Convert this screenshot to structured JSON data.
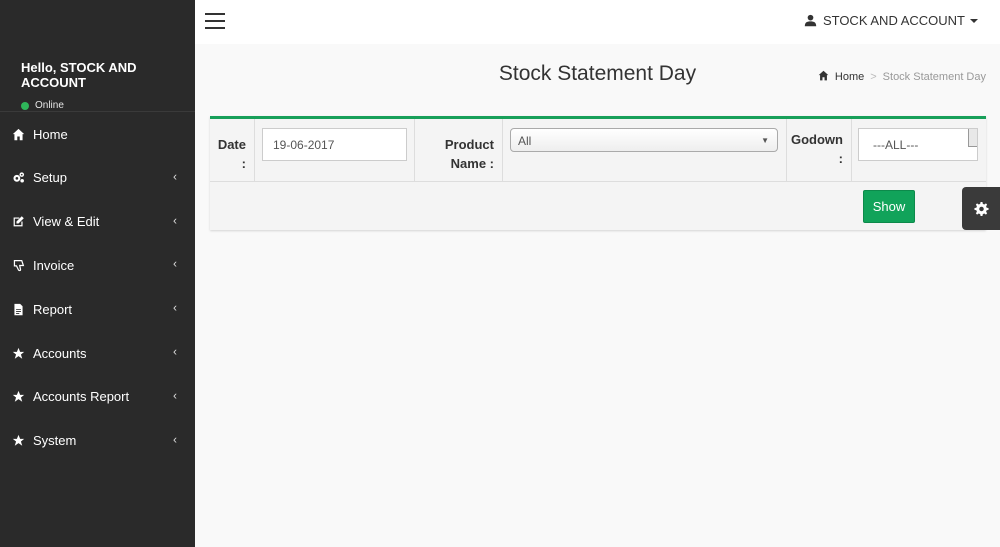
{
  "sidebar": {
    "greeting": "Hello, STOCK AND ACCOUNT",
    "status": "Online",
    "items": [
      {
        "label": "Home",
        "icon": "home-icon"
      },
      {
        "label": "Setup",
        "icon": "cogs-icon"
      },
      {
        "label": "View & Edit",
        "icon": "edit-icon"
      },
      {
        "label": "Invoice",
        "icon": "thumbs-down-icon"
      },
      {
        "label": "Report",
        "icon": "file-icon"
      },
      {
        "label": "Accounts",
        "icon": "star-icon"
      },
      {
        "label": "Accounts Report",
        "icon": "star-icon"
      },
      {
        "label": "System",
        "icon": "star-icon"
      }
    ],
    "chevron": "‹"
  },
  "topbar": {
    "user_name": "STOCK AND ACCOUNT"
  },
  "page": {
    "title": "Stock Statement Day",
    "breadcrumb_home": "Home",
    "breadcrumb_sep": ">",
    "breadcrumb_current": "Stock Statement Day"
  },
  "filters": {
    "date_label_1": "Date",
    "date_label_2": ":",
    "date_value": "19-06-2017",
    "product_label_1": "Product",
    "product_label_2": "Name :",
    "product_value": "All",
    "godown_label_1": "Godown",
    "godown_label_2": ":",
    "godown_value": "---ALL---",
    "show_label": "Show"
  },
  "colors": {
    "accent": "#11a35a",
    "sidebar_bg": "#2a2a2a"
  }
}
